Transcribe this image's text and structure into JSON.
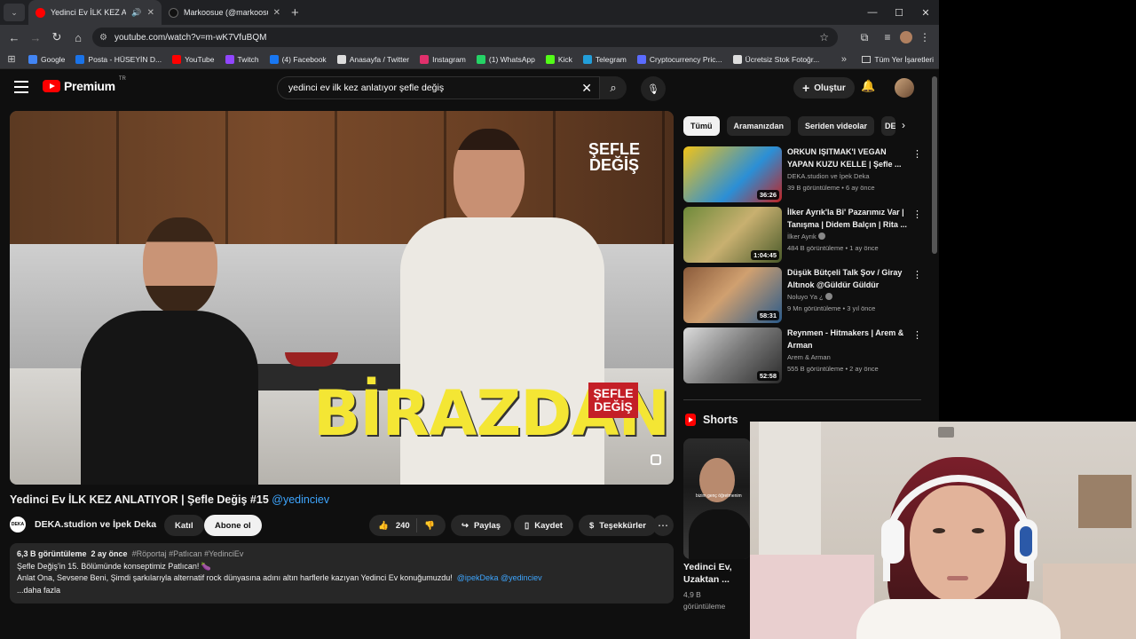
{
  "browser": {
    "tabs": [
      {
        "title": "Yedinci Ev İLK KEZ ANLATIY",
        "active": true,
        "favicon_color": "#ff0000"
      },
      {
        "title": "Markoosue (@markoosue) | Tik",
        "active": false,
        "favicon_color": "#111111"
      }
    ],
    "url": "youtube.com/watch?v=m-wK7VfuBQM",
    "bookmarks": [
      {
        "label": "Google",
        "color": "#4285f4"
      },
      {
        "label": "Posta - HÜSEYİN D...",
        "color": "#1a73e8"
      },
      {
        "label": "YouTube",
        "color": "#ff0000"
      },
      {
        "label": "Twitch",
        "color": "#9146ff"
      },
      {
        "label": "(4) Facebook",
        "color": "#1877f2"
      },
      {
        "label": "Anasayfa / Twitter",
        "color": "#dddddd"
      },
      {
        "label": "Instagram",
        "color": "#e1306c"
      },
      {
        "label": "(1) WhatsApp",
        "color": "#25d366"
      },
      {
        "label": "Kick",
        "color": "#53fc18"
      },
      {
        "label": "Telegram",
        "color": "#229ed9"
      },
      {
        "label": "Cryptocurrency Pric...",
        "color": "#5b6cff"
      },
      {
        "label": "Ücretsiz Stok Fotoğr...",
        "color": "#dddddd"
      }
    ],
    "bookmarks_folder": "Tüm Yer İşaretleri"
  },
  "youtube": {
    "logo_word": "Premium",
    "logo_region": "TR",
    "search_query": "yedinci ev ilk kez anlatıyor şefle değiş",
    "create_label": "Oluştur",
    "video": {
      "overlay_text": "BİRAZDAN...",
      "badge_line1": "ŞEFLE",
      "badge_line2": "DEĞİŞ",
      "title": "Yedinci Ev İLK KEZ ANLATIYOR | Şefle Değiş #15",
      "title_mention": "@yedinciev",
      "channel_avatar_text": "DEKA",
      "channel_name": "DEKA.studion ve İpek Deka",
      "join_label": "Katıl",
      "subscribe_label": "Abone ol",
      "likes": "240",
      "share_label": "Paylaş",
      "save_label": "Kaydet",
      "thanks_label": "Teşekkürler"
    },
    "description": {
      "views": "6,3 B görüntüleme",
      "age": "2 ay önce",
      "tags": "#Röportaj #Patlıcan #YedinciEv",
      "line1": "Şefle Değiş'in 15. Bölümünde konseptimiz Patlıcan! 🍆",
      "line2": "Anlat Ona, Sevsene Beni, Şimdi şarkılarıyla alternatif rock dünyasına adını altın harflerle kazıyan Yedinci Ev konuğumuzdu!",
      "line2_links": "@ipekDeka @yedinciev",
      "more_label": "...daha fazla"
    },
    "chips": [
      "Tümü",
      "Aramanızdan",
      "Seriden videolar",
      "DE"
    ],
    "recommendations": [
      {
        "title": "ORKUN IŞITMAK'I VEGAN YAPAN KUZU KELLE | Şefle ...",
        "channel": "DEKA.studion ve İpek Deka",
        "meta": "39 B görüntüleme • 6 ay önce",
        "duration": "36:26",
        "verified": false
      },
      {
        "title": "İlker Ayrık'la Bi' Pazarımız Var | Tanışma | Didem Balçın | Rita ...",
        "channel": "İlker Ayrık",
        "meta": "484 B görüntüleme • 1 ay önce",
        "duration": "1:04:45",
        "verified": true
      },
      {
        "title": "Düşük Bütçeli Talk Şov / Giray Altınok @Güldür Güldür",
        "channel": "Noluyo Ya ¿",
        "meta": "9 Mn görüntüleme • 3 yıl önce",
        "duration": "58:31",
        "verified": true
      },
      {
        "title": "Reynmen - Hitmakers | Arem & Arman",
        "channel": "Arem & Arman",
        "meta": "555 B görüntüleme • 2 ay önce",
        "duration": "52:58",
        "verified": false
      }
    ],
    "shorts": {
      "heading": "Shorts",
      "card_overlay": "bizim genç öğretmenim",
      "card_title": "Yedinci Ev, Uzaktan ...",
      "card_views": "4,9 B",
      "card_views_suffix": "görüntüleme"
    }
  }
}
